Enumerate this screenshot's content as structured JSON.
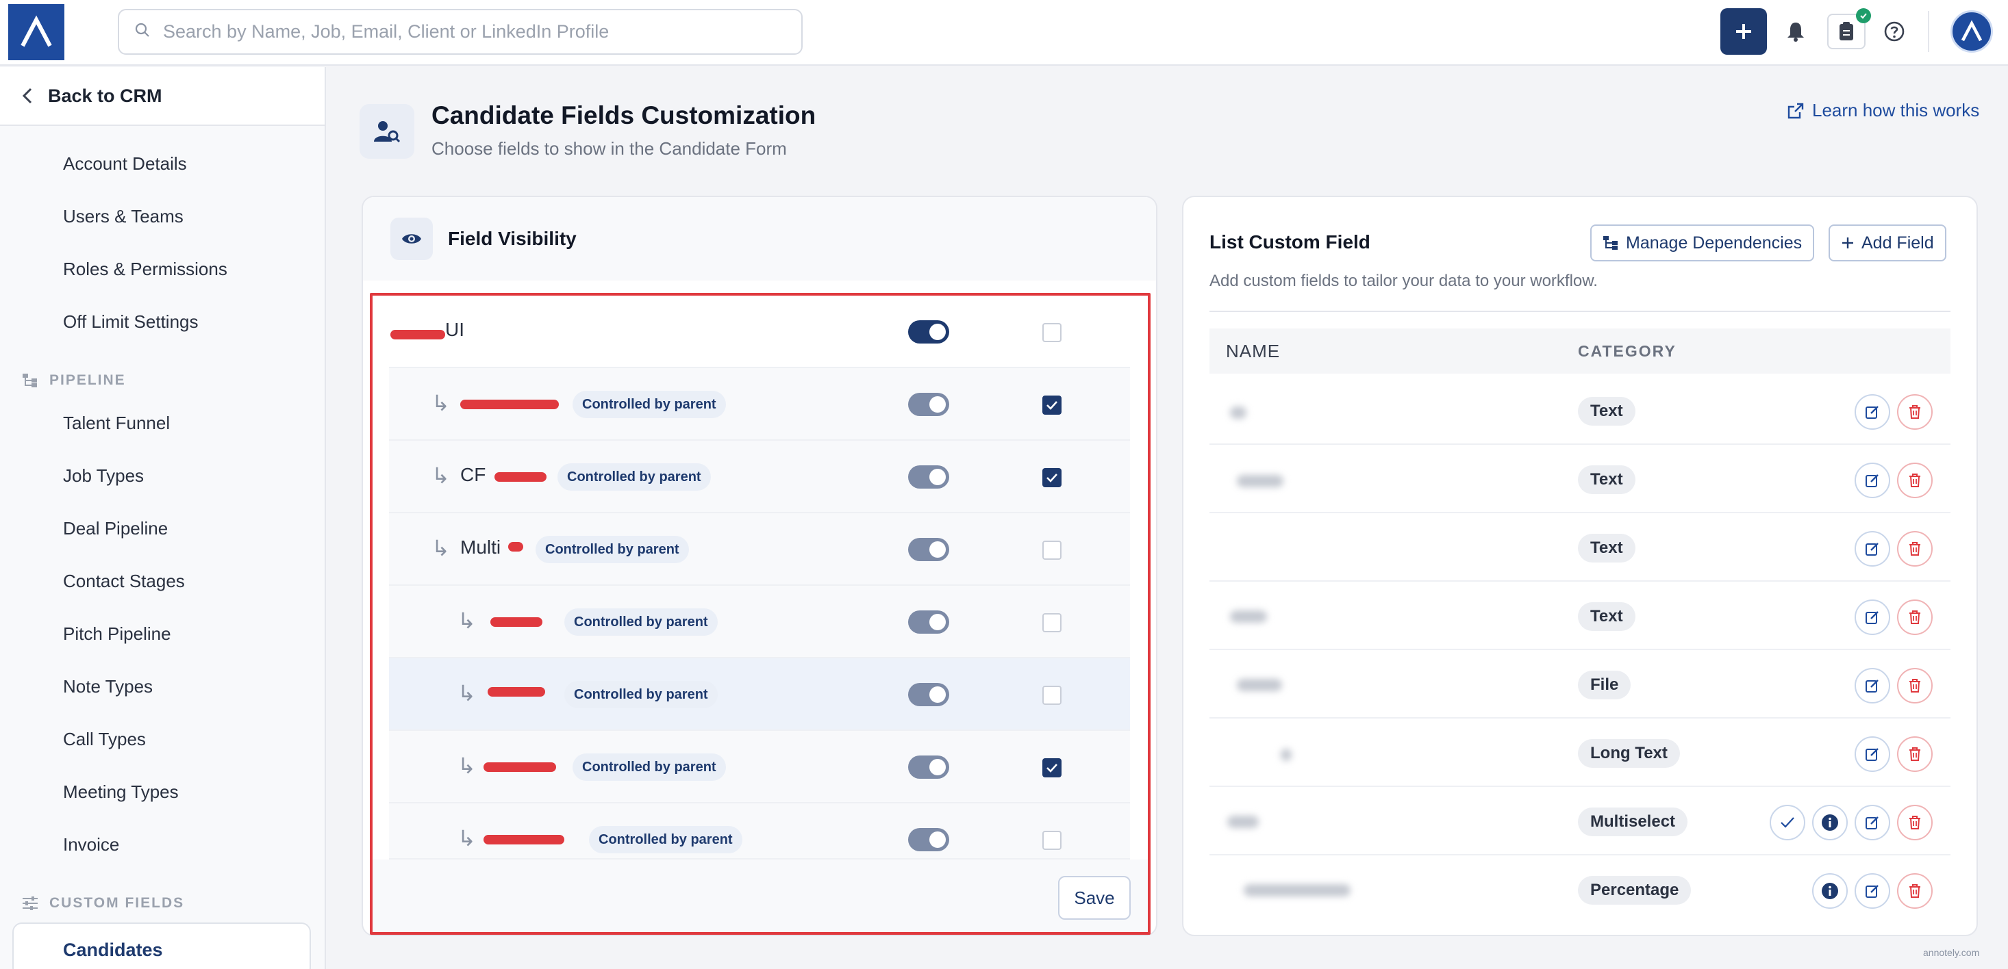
{
  "topbar": {
    "search_placeholder": "Search by Name, Job, Email, Client or LinkedIn Profile",
    "icons": [
      "search-icon",
      "plus-icon",
      "bell-icon",
      "clipboard-icon",
      "help-icon"
    ]
  },
  "sidebar": {
    "back_label": "Back to CRM",
    "items_top": [
      "Account Details",
      "Users & Teams",
      "Roles & Permissions",
      "Off Limit Settings"
    ],
    "pipeline_title": "PIPELINE",
    "pipeline_items": [
      "Talent Funnel",
      "Job Types",
      "Deal Pipeline",
      "Contact Stages",
      "Pitch Pipeline",
      "Note Types",
      "Call Types",
      "Meeting Types",
      "Invoice"
    ],
    "custom_fields_title": "CUSTOM FIELDS",
    "active_item": "Candidates"
  },
  "header": {
    "title": "Candidate Fields Customization",
    "subtitle": "Choose fields to show in the Candidate Form",
    "learn_link": "Learn how this works"
  },
  "field_visibility": {
    "title": "Field Visibility",
    "rows": [
      {
        "label": "UI",
        "badge": "",
        "toggle_on": true,
        "checked": false
      },
      {
        "label": "",
        "badge": "Controlled by parent",
        "toggle_on": false,
        "checked": true
      },
      {
        "label": "CF",
        "badge": "Controlled by parent",
        "toggle_on": false,
        "checked": true
      },
      {
        "label": "Multi",
        "badge": "Controlled by parent",
        "toggle_on": false,
        "checked": false
      },
      {
        "label": "",
        "badge": "Controlled by parent",
        "toggle_on": false,
        "checked": false
      },
      {
        "label": "",
        "badge": "Controlled by parent",
        "toggle_on": false,
        "checked": false
      },
      {
        "label": "",
        "badge": "Controlled by parent",
        "toggle_on": false,
        "checked": true
      },
      {
        "label": "",
        "badge": "Controlled by parent",
        "toggle_on": false,
        "checked": false
      }
    ],
    "save_label": "Save"
  },
  "custom_fields": {
    "title": "List Custom Field",
    "subtitle": "Add custom fields to tailor your data to your workflow.",
    "manage_label": "Manage Dependencies",
    "add_label": "Add Field",
    "col_name": "NAME",
    "col_category": "CATEGORY",
    "rows": [
      {
        "category": "Text"
      },
      {
        "category": "Text"
      },
      {
        "category": "Text"
      },
      {
        "category": "Text"
      },
      {
        "category": "File"
      },
      {
        "category": "Long Text"
      },
      {
        "category": "Multiselect"
      },
      {
        "category": "Percentage"
      }
    ]
  },
  "colors": {
    "brand": "#1e4b9e",
    "navy": "#1e3a6e",
    "highlight_frame": "#e0393e",
    "delete": "#e0393e"
  },
  "watermark": "annotely.com"
}
